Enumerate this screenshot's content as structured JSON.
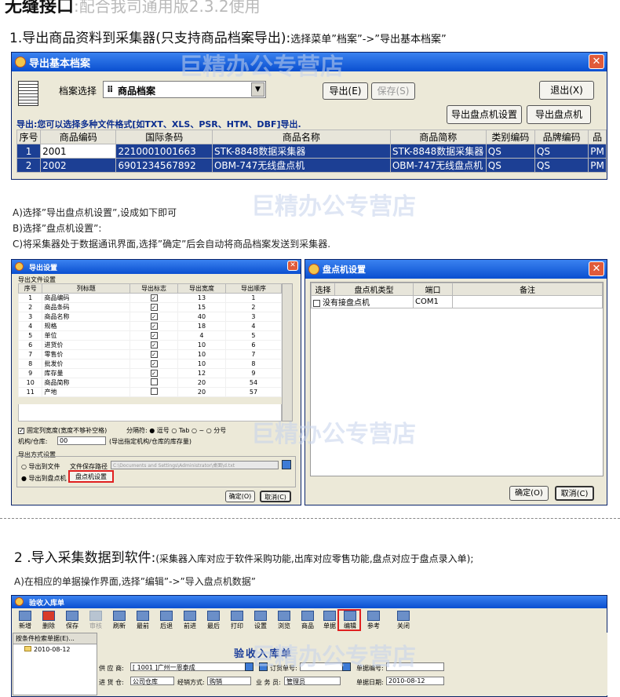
{
  "header_cut": {
    "title": "无缝接口",
    "subtitle": ":配合我司通用版2.3.2使用"
  },
  "section1": {
    "title": "1.导出商品资料到采集器(只支持商品档案导出):",
    "hint": "选择菜单”档案”->”导出基本档案”"
  },
  "win1": {
    "title": "导出基本档案",
    "archive_label": "档案选择",
    "archive_value": "商品档案",
    "export_btn": "导出(E)",
    "save_btn": "保存(S)",
    "exit_btn": "退出(X)",
    "pd_settings_btn": "导出盘点机设置",
    "pd_export_btn": "导出盘点机",
    "format_note": "导出:您可以选择多种文件格式[如TXT、XLS、PSR、HTM、DBF]导出.",
    "columns": [
      "序号",
      "商品编码",
      "国际条码",
      "商品名称",
      "商品简称",
      "类别编码",
      "品牌编码",
      "品"
    ],
    "rows": [
      [
        "1",
        "2001",
        "2210001001663",
        "STK-8848数据采集器",
        "STK-8848数据采集器",
        "QS",
        "QS",
        "PM"
      ],
      [
        "2",
        "2002",
        "6901234567892",
        "OBM-747无线盘点机",
        "OBM-747无线盘点机",
        "QS",
        "QS",
        "PM"
      ]
    ]
  },
  "steps": [
    "A)选择”导出盘点机设置”,设成如下即可",
    "B)选择”盘点机设置”:",
    "C)将采集器处于数据通讯界面,选择”确定”后会自动将商品档案发送到采集器."
  ],
  "win2": {
    "title": "导出设置",
    "group": "导出文件设置",
    "columns": [
      "序号",
      "列标题",
      "导出标志",
      "导出宽度",
      "导出顺序"
    ],
    "rows": [
      [
        "1",
        "商品编码",
        "✓",
        "13",
        "1"
      ],
      [
        "2",
        "商品条码",
        "✓",
        "15",
        "2"
      ],
      [
        "3",
        "商品名称",
        "✓",
        "40",
        "3"
      ],
      [
        "4",
        "规格",
        "✓",
        "18",
        "4"
      ],
      [
        "5",
        "单位",
        "✓",
        "4",
        "5"
      ],
      [
        "6",
        "进货价",
        "✓",
        "10",
        "6"
      ],
      [
        "7",
        "零售价",
        "✓",
        "10",
        "7"
      ],
      [
        "8",
        "批发价",
        "✓",
        "10",
        "8"
      ],
      [
        "9",
        "库存量",
        "✓",
        "12",
        "9"
      ],
      [
        "10",
        "商品简称",
        "",
        "20",
        "54"
      ],
      [
        "11",
        "产地",
        "",
        "20",
        "57"
      ]
    ],
    "fixed_width": "固定列宽度(宽度不够补空格)",
    "separator_label": "分隔符:",
    "sep_opts": [
      "逗号",
      "Tab",
      "~",
      "分号"
    ],
    "org_label": "机构/仓库:",
    "org_value": "00",
    "org_note": "(导出指定机构/仓库的库存量)",
    "method_group": "导出方式设置",
    "to_file": "导出到文件",
    "save_path_label": "文件保存路径",
    "save_path": "C:\\Documents and Settings\\Administrator\\桌面\\d.txt",
    "to_pd": "导出到盘点机",
    "pd_settings": "盘点机设置",
    "ok": "确定(O)",
    "cancel": "取消(C)"
  },
  "win3": {
    "title": "盘点机设置",
    "columns": [
      "选择",
      "盘点机类型",
      "端口",
      "备注"
    ],
    "row": {
      "type": "没有接盘点机",
      "port": "COM1",
      "note": ""
    },
    "ok": "确定(O)",
    "cancel": "取消(C)"
  },
  "section2": {
    "title": "2 .导入采集数据到软件:",
    "hint": "(采集器入库对应于软件采购功能,出库对应零售功能,盘点对应于盘点录入单);"
  },
  "step2a": "A)在相应的单据操作界面,选择”编辑”->”导入盘点机数据”",
  "win4": {
    "title": "验收入库单",
    "toolbar": [
      "新增",
      "删除",
      "保存",
      "审核",
      "刷新",
      "最前",
      "后退",
      "前进",
      "最后",
      "打印",
      "设置",
      "浏览",
      "商品",
      "单据",
      "编辑",
      "参考",
      "关闭"
    ],
    "tree_tab": "按条件检索单据(E)...",
    "tree_item": "2010-08-12",
    "doc_title": "验收入库单",
    "supplier_label": "供 应 商:",
    "supplier_value": "[ 1001 ]广州一恩泰成",
    "order_label": "订货单号:",
    "docno_label": "单据编号:",
    "warehouse_label": "进 货 仓:",
    "warehouse_value": "公司仓库",
    "mode_label": "经销方式:",
    "mode_value": "购销",
    "staff_label": "业 务 员:",
    "staff_value": "管理员",
    "date_label": "单据日期:",
    "date_value": "2010-08-12"
  },
  "watermark": "巨精办公专营店"
}
